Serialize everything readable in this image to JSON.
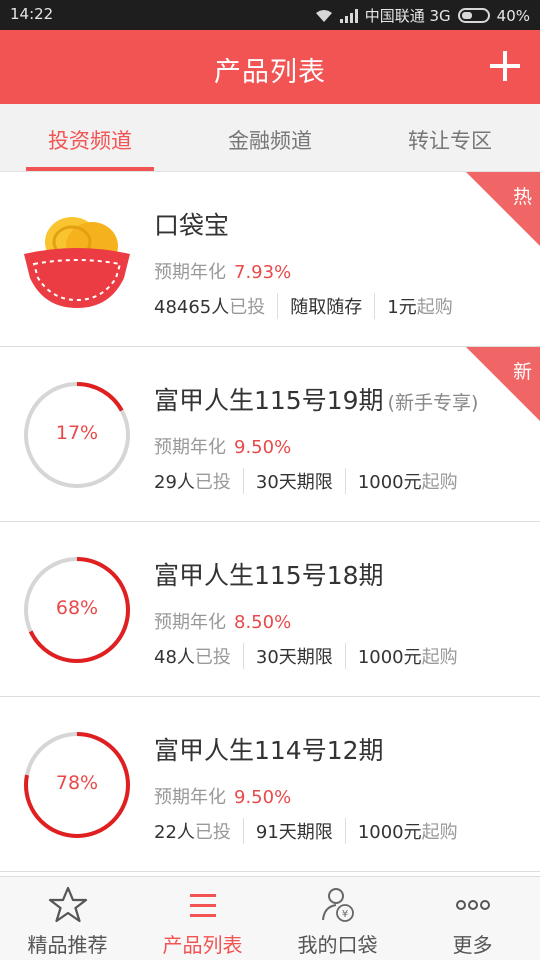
{
  "status_bar": {
    "time": "14:22",
    "carrier": "中国联通 3G",
    "battery": "40%"
  },
  "header": {
    "title": "产品列表",
    "add_icon": "plus-icon"
  },
  "tabs": [
    {
      "label": "投资频道",
      "active": true
    },
    {
      "label": "金融频道",
      "active": false
    },
    {
      "label": "转让专区",
      "active": false
    }
  ],
  "products": [
    {
      "name": "口袋宝",
      "note": "",
      "rate_label": "预期年化",
      "rate": "7.93%",
      "invested_count": "48465人",
      "invested_label": "已投",
      "term": "随取随存",
      "min_amount": "1元",
      "min_label": "起购",
      "badge": "热",
      "icon": "wallet-icon"
    },
    {
      "name": "富甲人生115号19期",
      "note": "(新手专享)",
      "rate_label": "预期年化",
      "rate": "9.50%",
      "invested_count": "29人",
      "invested_label": "已投",
      "term": "30天期限",
      "min_amount": "1000元",
      "min_label": "起购",
      "badge": "新",
      "progress": "17%",
      "progress_value": 17
    },
    {
      "name": "富甲人生115号18期",
      "note": "",
      "rate_label": "预期年化",
      "rate": "8.50%",
      "invested_count": "48人",
      "invested_label": "已投",
      "term": "30天期限",
      "min_amount": "1000元",
      "min_label": "起购",
      "badge": "",
      "progress": "68%",
      "progress_value": 68
    },
    {
      "name": "富甲人生114号12期",
      "note": "",
      "rate_label": "预期年化",
      "rate": "9.50%",
      "invested_count": "22人",
      "invested_label": "已投",
      "term": "91天期限",
      "min_amount": "1000元",
      "min_label": "起购",
      "badge": "",
      "progress": "78%",
      "progress_value": 78
    }
  ],
  "bottom_nav": [
    {
      "label": "精品推荐",
      "icon": "star-icon",
      "active": false
    },
    {
      "label": "产品列表",
      "icon": "list-icon",
      "active": true
    },
    {
      "label": "我的口袋",
      "icon": "user-wallet-icon",
      "active": false
    },
    {
      "label": "更多",
      "icon": "more-icon",
      "active": false
    }
  ],
  "colors": {
    "accent": "#f25353",
    "rate": "#e84a4a",
    "ring_track": "#d6d6d6",
    "ring_fill": "#e02020"
  }
}
